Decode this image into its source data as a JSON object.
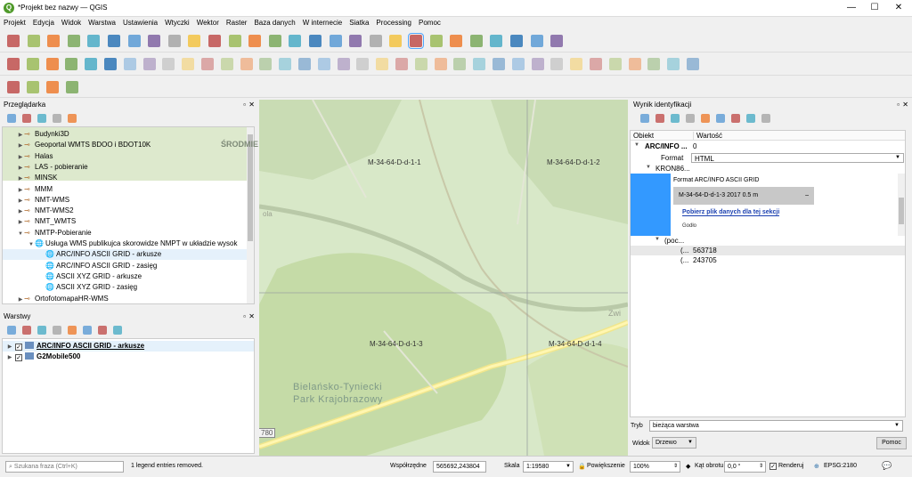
{
  "window": {
    "title": "*Projekt bez nazwy — QGIS",
    "min": "—",
    "max": "☐",
    "close": "✕"
  },
  "menu": [
    "Projekt",
    "Edycja",
    "Widok",
    "Warstwa",
    "Ustawienia",
    "Wtyczki",
    "Wektor",
    "Raster",
    "Baza danych",
    "W internecie",
    "Siatka",
    "Processing",
    "Pomoc"
  ],
  "browser": {
    "title": "Przeglądarka",
    "items": [
      {
        "label": "Budynki3D",
        "indent": 1
      },
      {
        "label": "Geoportal WMTS BDOO i BDOT10K",
        "indent": 1
      },
      {
        "label": "Halas",
        "indent": 1
      },
      {
        "label": "LAS - pobieranie",
        "indent": 1
      },
      {
        "label": "MINSK",
        "indent": 1
      },
      {
        "label": "MMM",
        "indent": 1
      },
      {
        "label": "NMT-WMS",
        "indent": 1
      },
      {
        "label": "NMT-WMS2",
        "indent": 1
      },
      {
        "label": "NMT_WMTS",
        "indent": 1
      },
      {
        "label": "NMTP-Pobieranie",
        "indent": 1,
        "open": true
      },
      {
        "label": "Usługa WMS publikujca skorowidze NMPT w układzie wysok",
        "indent": 2,
        "open": true
      },
      {
        "label": "ARC/INFO ASCII GRID - arkusze",
        "indent": 3,
        "selected": true
      },
      {
        "label": "ARC/INFO ASCII GRID - zasięg",
        "indent": 3
      },
      {
        "label": "ASCII XYZ GRID - arkusze",
        "indent": 3
      },
      {
        "label": "ASCII XYZ GRID - zasięg",
        "indent": 3
      },
      {
        "label": "OrtofotomapaHR-WMS",
        "indent": 1
      }
    ]
  },
  "layers": {
    "title": "Warstwy",
    "items": [
      {
        "label": "ARC/INFO ASCII GRID - arkusze",
        "checked": true,
        "underline": true
      },
      {
        "label": "G2Mobile500",
        "checked": true
      }
    ]
  },
  "map": {
    "labels": [
      {
        "text": "M-34-64-D-d-1-1"
      },
      {
        "text": "M-34-64-D-d-1-2"
      },
      {
        "text": "M-34-64-D-d-1-3"
      },
      {
        "text": "M-34-64-D-d-1-4"
      }
    ],
    "district": "ŚRODMIE",
    "park": "Bielańsko-Tyniecki\nPark Krajobrazowy",
    "road": "780",
    "edge1": "ola",
    "edge2": "Zwi"
  },
  "identify": {
    "title": "Wynik identyfikacji",
    "col_feature": "Obiekt",
    "col_value": "Wartość",
    "root_label": "ARC/INFO ...",
    "root_value": "0",
    "format_label": "Format",
    "format_value": "HTML",
    "node": "KRON86...",
    "html_heading": "Format ARC/INFO ASCII GRID",
    "html_sheet": "M-34-64-D-d-1-3 2017 0.5 m",
    "html_dash": "–",
    "html_link": "Pobierz plik danych dla tej sekcji",
    "html_godlo": "Godło",
    "geom": "(poc...",
    "coord_x_label": "(...",
    "coord_x": "563718",
    "coord_y_label": "(...",
    "coord_y": "243705",
    "mode_label": "Tryb",
    "mode_value": "bieżąca warstwa",
    "view_label": "Widok",
    "view_value": "Drzewo",
    "help": "Pomoc"
  },
  "status": {
    "search_placeholder": "Szukana fraza (Ctrl+K)",
    "message": "1 legend entries removed.",
    "coord_label": "Współrzędne",
    "coord_value": "565692,243804",
    "scale_label": "Skala",
    "scale_value": "1:19580",
    "zoom_label": "Powiększenie",
    "zoom_value": "100%",
    "rot_label": "Kąt obrotu",
    "rot_value": "0,0 °",
    "render_label": "Renderuj",
    "crs": "EPSG:2180"
  },
  "colors": {
    "accent": "#3399ff",
    "map_bg": "#d8e8c8",
    "selection": "#cce4f7"
  }
}
